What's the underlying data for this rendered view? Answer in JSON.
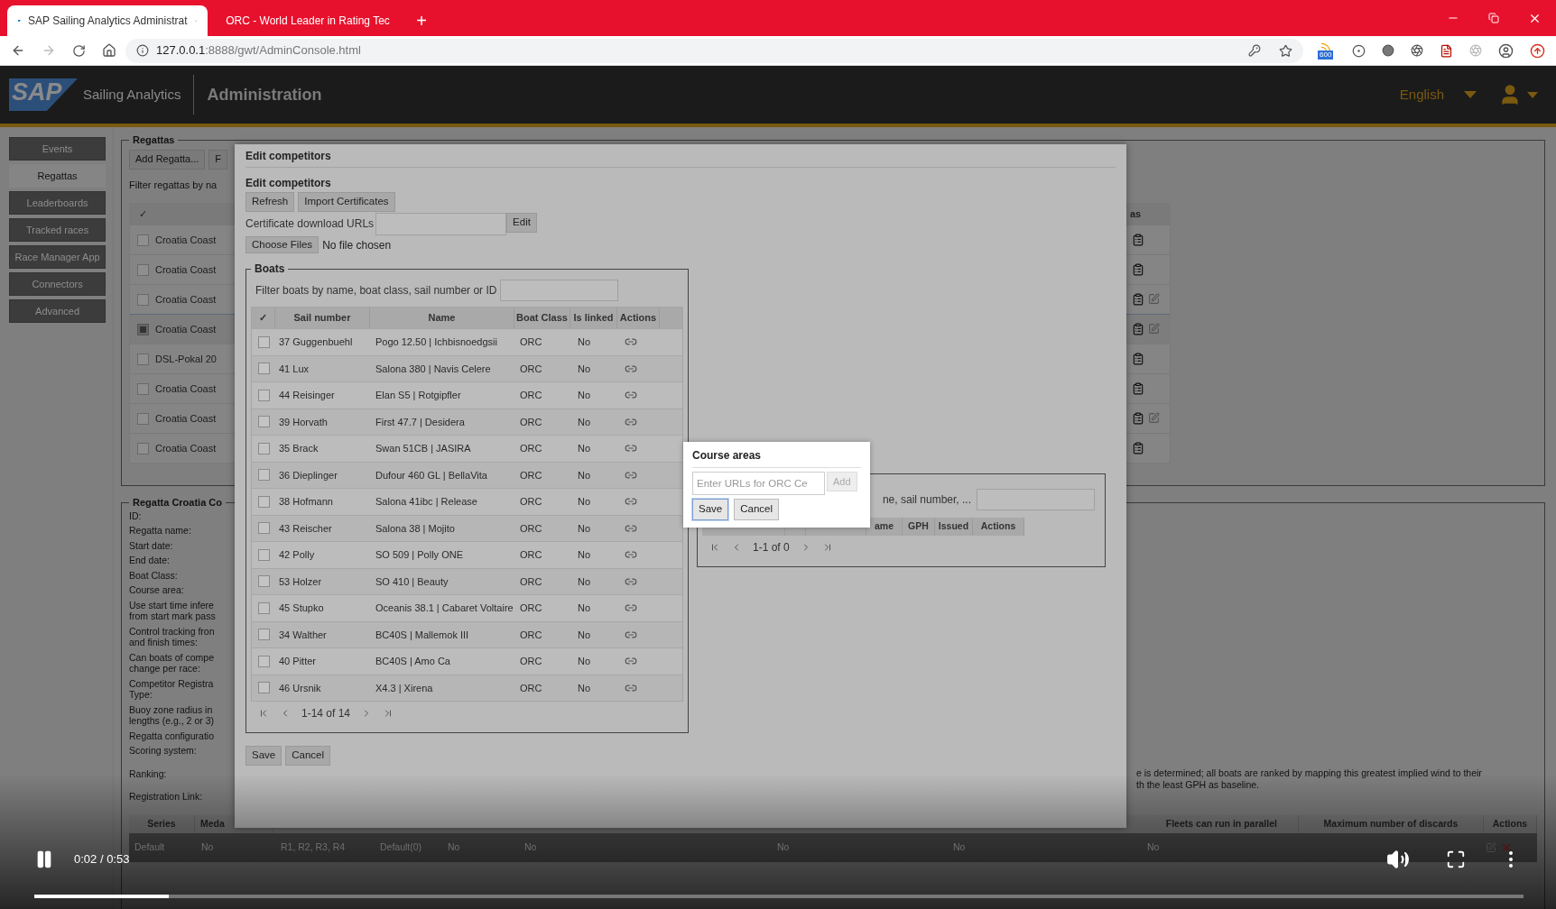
{
  "browser": {
    "tabs": [
      {
        "title": "SAP Sailing Analytics Administrat",
        "selected": true
      },
      {
        "title": "ORC - World Leader in Rating Tec",
        "selected": false
      }
    ],
    "new_tab": "+",
    "url_host": "127.0.0.1",
    "url_rest": ":8888/gwt/AdminConsole.html",
    "extension_badge": "600"
  },
  "header": {
    "logo": "SAP",
    "product": "Sailing Analytics",
    "title": "Administration",
    "language": "English"
  },
  "sidebar": {
    "items": [
      {
        "label": "Events",
        "selected": false
      },
      {
        "label": "Regattas",
        "selected": true
      },
      {
        "label": "Leaderboards",
        "selected": false
      },
      {
        "label": "Tracked races",
        "selected": false
      },
      {
        "label": "Race Manager App",
        "selected": false
      },
      {
        "label": "Connectors",
        "selected": false
      },
      {
        "label": "Advanced",
        "selected": false
      }
    ]
  },
  "regattas": {
    "legend": "Regattas",
    "buttons": [
      "Add Regatta...",
      "F"
    ],
    "filter_label": "Filter regattas by na",
    "check_header": "✓",
    "actions_header": "as",
    "rows": [
      {
        "name": "Croatia Coast",
        "selected": false,
        "extra_icon": false
      },
      {
        "name": "Croatia Coast",
        "selected": false,
        "extra_icon": false
      },
      {
        "name": "Croatia Coast",
        "selected": false,
        "extra_icon": true
      },
      {
        "name": "Croatia Coast",
        "selected": true,
        "extra_icon": true
      },
      {
        "name": "DSL-Pokal 20",
        "selected": false,
        "extra_icon": false
      },
      {
        "name": "Croatia Coast",
        "selected": false,
        "extra_icon": false
      },
      {
        "name": "Croatia Coast",
        "selected": false,
        "extra_icon": true
      },
      {
        "name": "Croatia Coast",
        "selected": false,
        "extra_icon": false
      }
    ]
  },
  "regatta_details": {
    "legend": "Regatta Croatia Co",
    "labels": [
      {
        "lines": [
          "ID:"
        ]
      },
      {
        "lines": [
          "Regatta name:"
        ]
      },
      {
        "lines": [
          "Start date:"
        ]
      },
      {
        "lines": [
          "End date:"
        ]
      },
      {
        "lines": [
          "Boat Class:"
        ]
      },
      {
        "lines": [
          "Course area:"
        ]
      },
      {
        "lines": [
          "Use start time infere",
          "from start mark pass"
        ]
      },
      {
        "lines": [
          "Control tracking fron",
          "and finish times:"
        ]
      },
      {
        "lines": [
          "Can boats of compe",
          "change per race:"
        ]
      },
      {
        "lines": [
          "Competitor Registra",
          "Type:"
        ]
      },
      {
        "lines": [
          "Buoy zone radius in",
          "lengths (e.g., 2 or 3)"
        ]
      },
      {
        "lines": [
          "Regatta configuratio"
        ]
      },
      {
        "lines": [
          "Scoring system:"
        ]
      },
      {
        "lines": [
          "Ranking:"
        ]
      },
      {
        "lines": [
          "Registration Link:"
        ]
      }
    ],
    "scoring_note": [
      "e is determined; all boats are ranked by mapping this greatest implied wind to their",
      "th the least GPH as baseline."
    ],
    "series_columns": [
      "Series",
      "Meda",
      "",
      "",
      "",
      "",
      "",
      "",
      "Fleets can run in parallel",
      "Maximum number of discards",
      "Actions"
    ],
    "series_row": [
      "Default",
      "No",
      "R1, R2, R3, R4",
      "Default(0)",
      "No",
      "No",
      "No",
      "No",
      "No"
    ]
  },
  "dialog": {
    "title": "Edit competitors",
    "subtitle": "Edit competitors",
    "buttons": [
      "Refresh",
      "Import Certificates"
    ],
    "cert_label": "Certificate download URLs",
    "cert_edit": "Edit",
    "choose_files": "Choose Files",
    "no_file": "No file chosen",
    "boats": {
      "legend": "Boats",
      "filter_label": "Filter boats by name, boat class, sail number or ID",
      "columns": [
        "✓",
        "Sail number",
        "Name",
        "Boat Class",
        "Is linked",
        "Actions"
      ],
      "rows": [
        {
          "sail": "37 Guggenbuehl",
          "name": "Pogo 12.50 | Ichbisnoedgsii",
          "class": "ORC",
          "linked": "No",
          "checked": false
        },
        {
          "sail": "41 Lux",
          "name": "Salona 380 | Navis Celere",
          "class": "ORC",
          "linked": "No",
          "checked": false
        },
        {
          "sail": "44 Reisinger",
          "name": "Elan S5 | Rotgipfler",
          "class": "ORC",
          "linked": "No",
          "checked": false
        },
        {
          "sail": "39 Horvath",
          "name": "First 47.7 | Desidera",
          "class": "ORC",
          "linked": "No",
          "checked": false
        },
        {
          "sail": "35 Brack",
          "name": "Swan 51CB | JASIRA",
          "class": "ORC",
          "linked": "No",
          "checked": false
        },
        {
          "sail": "36 Dieplinger",
          "name": "Dufour 460 GL | BellaVita",
          "class": "ORC",
          "linked": "No",
          "checked": false
        },
        {
          "sail": "38 Hofmann",
          "name": "Salona 41ibc | Release",
          "class": "ORC",
          "linked": "No",
          "checked": false
        },
        {
          "sail": "43 Reischer",
          "name": "Salona 38 | Mojito",
          "class": "ORC",
          "linked": "No",
          "checked": false
        },
        {
          "sail": "42 Polly",
          "name": "SO 509 | Polly ONE",
          "class": "ORC",
          "linked": "No",
          "checked": false
        },
        {
          "sail": "53 Holzer",
          "name": "SO 410 | Beauty",
          "class": "ORC",
          "linked": "No",
          "checked": false
        },
        {
          "sail": "45 Stupko",
          "name": "Oceanis 38.1 | Cabaret Voltaire",
          "class": "ORC",
          "linked": "No",
          "checked": false
        },
        {
          "sail": "34 Walther",
          "name": "BC40S | Mallemok III",
          "class": "ORC",
          "linked": "No",
          "checked": false
        },
        {
          "sail": "40 Pitter",
          "name": "BC40S | Amo Ca",
          "class": "ORC",
          "linked": "No",
          "checked": false
        },
        {
          "sail": "46 Ursnik",
          "name": "X4.3 | Xirena",
          "class": "ORC",
          "linked": "No",
          "checked": false
        }
      ],
      "pager": "1-14 of 14"
    },
    "certificates": {
      "filter_label": "ne, sail number, ...",
      "columns": [
        "",
        "",
        "",
        "ame",
        "GPH",
        "Issued",
        "Actions"
      ],
      "pager": "1-1 of 0"
    },
    "footer_buttons": [
      "Save",
      "Cancel"
    ]
  },
  "course_areas": {
    "title": "Course areas",
    "placeholder": "Enter URLs for ORC Ce",
    "add": "Add",
    "add_disabled": true,
    "save": "Save",
    "save_focused": true,
    "cancel": "Cancel"
  },
  "video": {
    "time": "0:02 / 0:53",
    "playing": true,
    "level": 0.09
  }
}
